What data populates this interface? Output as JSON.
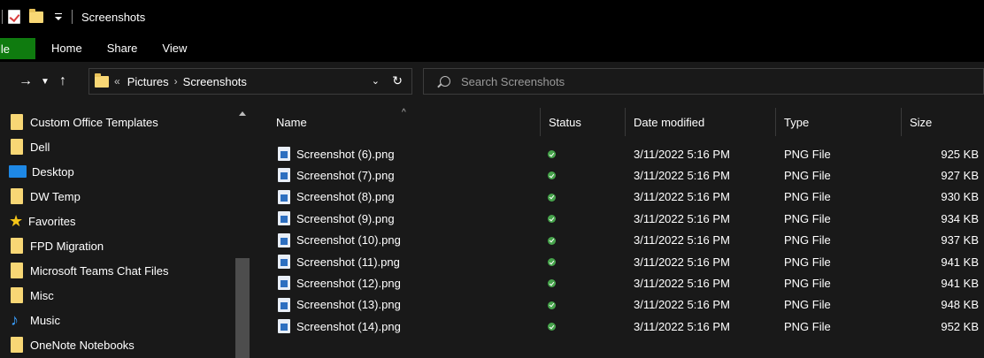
{
  "window": {
    "title": "Screenshots"
  },
  "ribbon": {
    "file_label": "File",
    "tabs": [
      "Home",
      "Share",
      "View"
    ]
  },
  "address": {
    "root_prefix": "«",
    "crumbs": [
      "Pictures",
      "Screenshots"
    ]
  },
  "search": {
    "placeholder": "Search Screenshots"
  },
  "nav": {
    "items": [
      {
        "label": "Custom Office Templates",
        "icon": "folder-icon"
      },
      {
        "label": "Dell",
        "icon": "folder-icon"
      },
      {
        "label": "Desktop",
        "icon": "desktop-icon"
      },
      {
        "label": "DW Temp",
        "icon": "folder-icon"
      },
      {
        "label": "Favorites",
        "icon": "star-icon"
      },
      {
        "label": "FPD Migration",
        "icon": "folder-icon"
      },
      {
        "label": "Microsoft Teams Chat Files",
        "icon": "folder-icon"
      },
      {
        "label": "Misc",
        "icon": "folder-icon"
      },
      {
        "label": "Music",
        "icon": "music-note-icon"
      },
      {
        "label": "OneNote Notebooks",
        "icon": "folder-icon"
      }
    ]
  },
  "columns": {
    "name": "Name",
    "status": "Status",
    "date": "Date modified",
    "type": "Type",
    "size": "Size"
  },
  "files": [
    {
      "name": "Screenshot (6).png",
      "date": "3/11/2022 5:16 PM",
      "type": "PNG File",
      "size": "925 KB"
    },
    {
      "name": "Screenshot (7).png",
      "date": "3/11/2022 5:16 PM",
      "type": "PNG File",
      "size": "927 KB"
    },
    {
      "name": "Screenshot (8).png",
      "date": "3/11/2022 5:16 PM",
      "type": "PNG File",
      "size": "930 KB"
    },
    {
      "name": "Screenshot (9).png",
      "date": "3/11/2022 5:16 PM",
      "type": "PNG File",
      "size": "934 KB"
    },
    {
      "name": "Screenshot (10).png",
      "date": "3/11/2022 5:16 PM",
      "type": "PNG File",
      "size": "937 KB"
    },
    {
      "name": "Screenshot (11).png",
      "date": "3/11/2022 5:16 PM",
      "type": "PNG File",
      "size": "941 KB"
    },
    {
      "name": "Screenshot (12).png",
      "date": "3/11/2022 5:16 PM",
      "type": "PNG File",
      "size": "941 KB"
    },
    {
      "name": "Screenshot (13).png",
      "date": "3/11/2022 5:16 PM",
      "type": "PNG File",
      "size": "948 KB"
    },
    {
      "name": "Screenshot (14).png",
      "date": "3/11/2022 5:16 PM",
      "type": "PNG File",
      "size": "952 KB"
    }
  ],
  "colors": {
    "file_tab": "#0f7b0f",
    "status_ok": "#46a34b",
    "folder": "#f8d775"
  }
}
